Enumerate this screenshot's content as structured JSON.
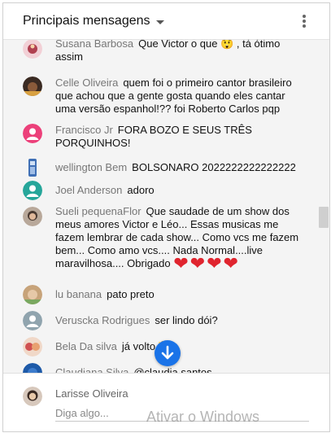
{
  "header": {
    "title": "Principais mensagens",
    "dropdown_icon": "caret-down-icon",
    "menu_icon": "more-vert-icon"
  },
  "messages": [
    {
      "author": "Susana Barbosa",
      "text": "Que Victor o que 😲 , tá ótimo assim"
    },
    {
      "author": "Celle Oliveira",
      "text": "quem foi o primeiro cantor brasileiro que achou que a gente gosta quando eles cantar uma versão espanhol!?? foi Roberto Carlos pqp"
    },
    {
      "author": "Francisco Jr",
      "text": "FORA BOZO E SEUS TRÊS PORQUINHOS!"
    },
    {
      "author": "wellington Bem",
      "text": "BOLSONARO 2022222222222222"
    },
    {
      "author": "Joel Anderson",
      "text": "adoro"
    },
    {
      "author": "Sueli pequenaFlor",
      "text": "Que saudade de um show dos meus amores Victor e Léo... Essas musicas me fazem lembrar de cada show... Como vcs me fazem bem... Como amo vcs.... Nada Normal....live maravilhosa.... Obrigado",
      "emoji": "❤❤❤❤"
    },
    {
      "author": "lu banana",
      "text": "pato preto"
    },
    {
      "author": "Veruscka Rodrigues",
      "text": "ser lindo dói?"
    },
    {
      "author": "Bela Da silva",
      "text": "já volto 👑"
    },
    {
      "author": "Claudiana Silva",
      "text": "@claudia santos"
    }
  ],
  "compose": {
    "user_name": "Larisse Oliveira",
    "placeholder": "Diga algo..."
  },
  "scroll_button_icon": "arrow-down-icon",
  "watermark": "Ativar o Windows",
  "colors": {
    "accent": "#1a73e8",
    "chat_bg": "#f4f4f4",
    "heart": "#e0242e"
  }
}
